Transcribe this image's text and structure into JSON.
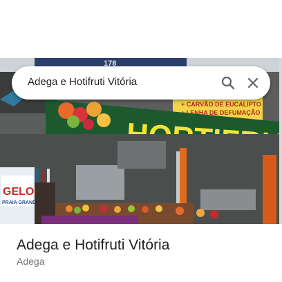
{
  "search": {
    "value": "Adega e Hotifruti Vitória"
  },
  "photo": {
    "banner_text": "HORTIFRUT",
    "sign_small_line1": "+ CARVÃO DE EUCALIPTO",
    "sign_small_line2": "+ LENHA DE DEFUMAÇÃO",
    "ice_label_1": "GELO",
    "ice_label_2": "PRAIA GRANDE",
    "top_sign_number": "178",
    "banner_color": "#1c5a2e",
    "banner_text_color": "#f2e23a"
  },
  "place": {
    "title": "Adega e Hotifruti Vitória",
    "category": "Adega"
  },
  "icons": {
    "search": "search-icon",
    "close": "close-icon"
  }
}
